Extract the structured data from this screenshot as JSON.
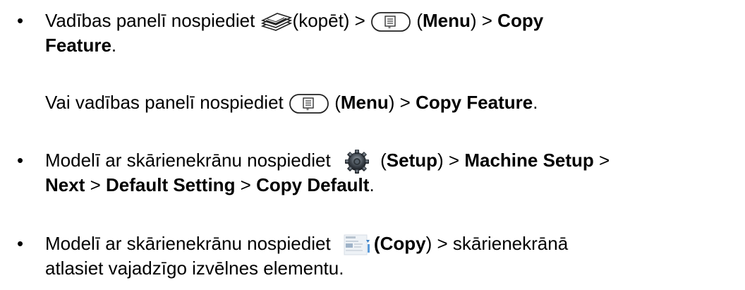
{
  "bullets": [
    "•",
    "•",
    "•"
  ],
  "item1": {
    "line1": {
      "pre": "Vadības panelī nospiediet ",
      "copy_icon_text": "(kopēt) > ",
      "menu_open": " (",
      "menu": "Menu",
      "gt": ") > ",
      "copy": "Copy"
    },
    "line2": {
      "feature": "Feature",
      "dot": "."
    },
    "alt": {
      "pre": "Vai vadības panelī nospiediet ",
      "menu_open": " (",
      "menu": "Menu",
      "gt": ") > ",
      "copy_feature": "Copy Feature",
      "dot": "."
    }
  },
  "item2": {
    "line1": {
      "pre": "Modelī ar skārienekrānu nospiediet ",
      "setup_open": " (",
      "setup": "Setup",
      "gt1": ") > ",
      "machine_setup": "Machine Setup",
      "gt2": " >"
    },
    "line2": {
      "next": "Next",
      "gt1": " > ",
      "default_setting": "Default Setting",
      "gt2": " > ",
      "copy_default": "Copy Default",
      "dot": "."
    }
  },
  "item3": {
    "line1": {
      "pre": "Modelī ar skārienekrānu nospiediet ",
      "copy_open": "(",
      "copy": "Copy",
      "post": ") > skārienekrānā"
    },
    "line2": {
      "text": "atlasiet vajadzīgo izvēlnes elementu."
    }
  },
  "icons": {
    "copy": "copy-icon",
    "menu": "menu-button-icon",
    "setup": "setup-gear-icon",
    "copy_screen": "copy-screen-icon"
  }
}
